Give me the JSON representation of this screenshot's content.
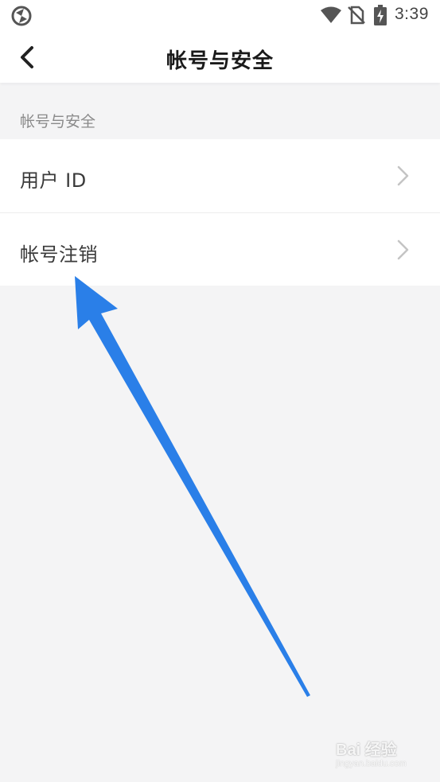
{
  "status_bar": {
    "time": "3:39",
    "icons": [
      "app-logo-icon",
      "wifi-icon",
      "no-sim-icon",
      "battery-charging-icon"
    ]
  },
  "header": {
    "title": "帐号与安全",
    "back_icon": "chevron-left-icon"
  },
  "section": {
    "header": "帐号与安全",
    "items": [
      {
        "label": "用户 ID",
        "icon": "chevron-right-icon"
      },
      {
        "label": "帐号注销",
        "icon": "chevron-right-icon"
      }
    ]
  },
  "overlay": {
    "arrow_icon": "annotation-arrow-icon",
    "arrow_color": "#2a7fe8"
  },
  "watermark": {
    "brand": "Bai 经验",
    "url": "jingyan.baidu.com"
  },
  "colors": {
    "background": "#f4f4f5",
    "surface": "#ffffff",
    "title_text": "#1a1a1a",
    "section_text": "#8a8a8a",
    "chevron": "#c4c4c4"
  }
}
